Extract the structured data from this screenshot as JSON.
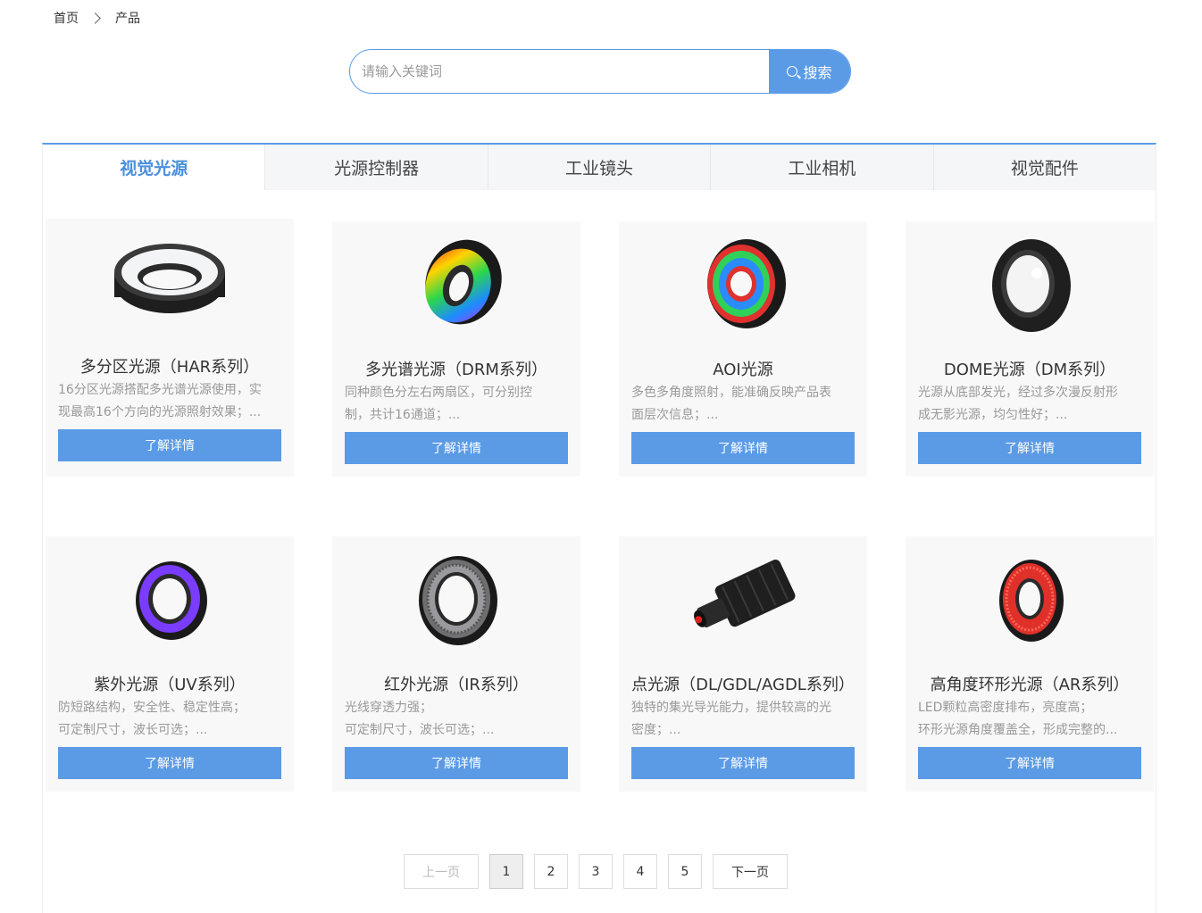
{
  "breadcrumb": {
    "home": "首页",
    "current": "产品"
  },
  "search": {
    "placeholder": "请输入关键词",
    "button_label": "搜索"
  },
  "tabs": [
    {
      "label": "视觉光源",
      "active": true
    },
    {
      "label": "光源控制器"
    },
    {
      "label": "工业镜头"
    },
    {
      "label": "工业相机"
    },
    {
      "label": "视觉配件"
    }
  ],
  "products": [
    {
      "title": "多分区光源（HAR系列）",
      "desc1": "16分区光源搭配多光谱光源使用，实",
      "desc2": "现最高16个方向的光源照射效果；...",
      "button": "了解详情",
      "icon": "ring-light-white"
    },
    {
      "title": "多光谱光源（DRM系列）",
      "desc1": "同种颜色分左右两扇区，可分别控",
      "desc2": "制，共计16通道；...",
      "button": "了解详情",
      "icon": "rainbow-ring-light"
    },
    {
      "title": "AOI光源",
      "desc1": "多色多角度照射，能准确反映产品表",
      "desc2": "面层次信息；...",
      "button": "了解详情",
      "icon": "rgb-ring-light"
    },
    {
      "title": "DOME光源（DM系列）",
      "desc1": "光源从底部发光，经过多次漫反射形",
      "desc2": "成无影光源，均匀性好；...",
      "button": "了解详情",
      "icon": "dome-light"
    },
    {
      "title": "紫外光源（UV系列）",
      "desc1": "防短路结构，安全性、稳定性高；",
      "desc2": "可定制尺寸，波长可选；...",
      "button": "了解详情",
      "icon": "uv-ring-light"
    },
    {
      "title": "红外光源（IR系列）",
      "desc1": "光线穿透力强；",
      "desc2": "可定制尺寸，波长可选；...",
      "button": "了解详情",
      "icon": "ir-ring-light"
    },
    {
      "title": "点光源（DL/GDL/AGDL系列）",
      "desc1": "独特的集光导光能力，提供较高的光",
      "desc2": "密度；...",
      "button": "了解详情",
      "icon": "spot-light"
    },
    {
      "title": "高角度环形光源（AR系列）",
      "desc1": "LED颗粒高密度排布，亮度高；",
      "desc2": "环形光源角度覆盖全，形成完整的...",
      "button": "了解详情",
      "icon": "red-ring-light"
    }
  ],
  "pagination": {
    "prev": "上一页",
    "pages": [
      "1",
      "2",
      "3",
      "4",
      "5"
    ],
    "current": "1",
    "next": "下一页"
  },
  "colors": {
    "accent": "#5b9be6",
    "tab_active_text": "#4a8fdc",
    "card_bg": "#f8f8f8",
    "desc_text": "#999999"
  }
}
